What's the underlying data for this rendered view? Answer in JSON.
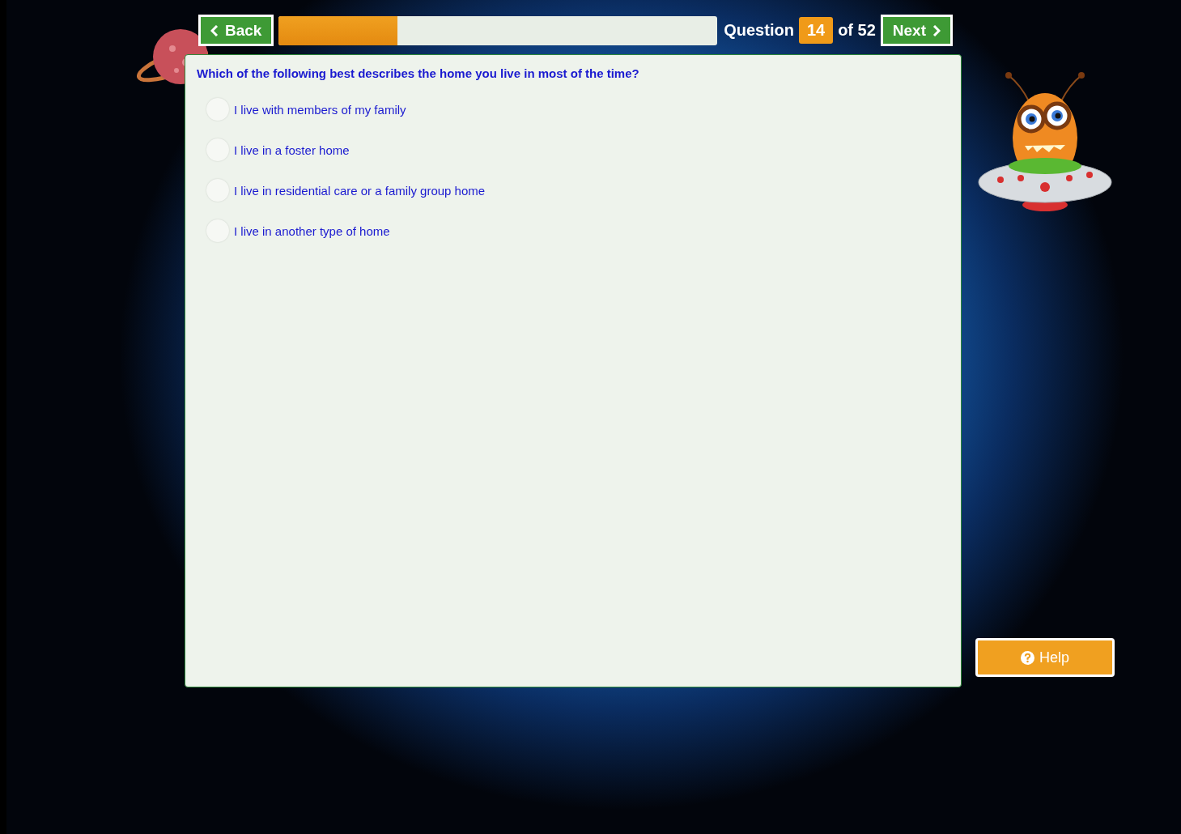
{
  "nav": {
    "back": "Back",
    "progress": {
      "level": 0.27
    },
    "question_label": "Question",
    "question_number": "14",
    "question_total": "of 52",
    "next": "Next"
  },
  "question": {
    "text": "Which of the following best describes the home you live in most of the time?",
    "options": [
      {
        "label": "I live with members of my family",
        "selected": false
      },
      {
        "label": "I live in a foster home",
        "selected": false
      },
      {
        "label": "I live in residential care or a family group home",
        "selected": false
      },
      {
        "label": "I live in another type of home",
        "selected": false
      }
    ]
  },
  "help": {
    "label": "Help"
  }
}
